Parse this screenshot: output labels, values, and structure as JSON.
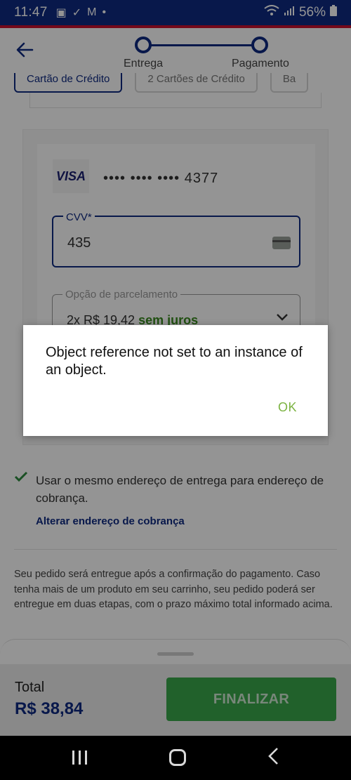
{
  "status_bar": {
    "time": "11:47",
    "battery": "56%"
  },
  "header": {
    "steps": [
      {
        "label": "Entrega"
      },
      {
        "label": "Pagamento"
      }
    ]
  },
  "payment_tabs": [
    {
      "label": "Cartão de Crédito",
      "active": true
    },
    {
      "label": "2 Cartões de Crédito",
      "active": false
    },
    {
      "label": "Ba",
      "active": false
    }
  ],
  "card": {
    "brand": "VISA",
    "masked_number": "•••• •••• •••• 4377",
    "cvv_label": "CVV*",
    "cvv_value": "435",
    "installment_label": "Opção de parcelamento",
    "installment_value": "2x R$ 19,42",
    "installment_note": "sem juros"
  },
  "billing": {
    "same_address_text": "Usar o mesmo endereço de entrega para endereço de cobrança.",
    "change_link": "Alterar endereço de cobrança"
  },
  "info_text": "Seu pedido será entregue após a confirmação do pagamento. Caso tenha mais de um produto em seu carrinho, seu pedido poderá ser entregue em duas etapas, com o prazo máximo total informado acima.",
  "footer": {
    "total_label": "Total",
    "total_value": "R$ 38,84",
    "finalize_label": "FINALIZAR"
  },
  "dialog": {
    "message": "Object reference not set to an instance of an object.",
    "ok_label": "OK"
  },
  "colors": {
    "brand_blue": "#0f2a82",
    "accent_red": "#c8102e",
    "success_green": "#3aa84a",
    "dialog_ok": "#7cb342"
  }
}
